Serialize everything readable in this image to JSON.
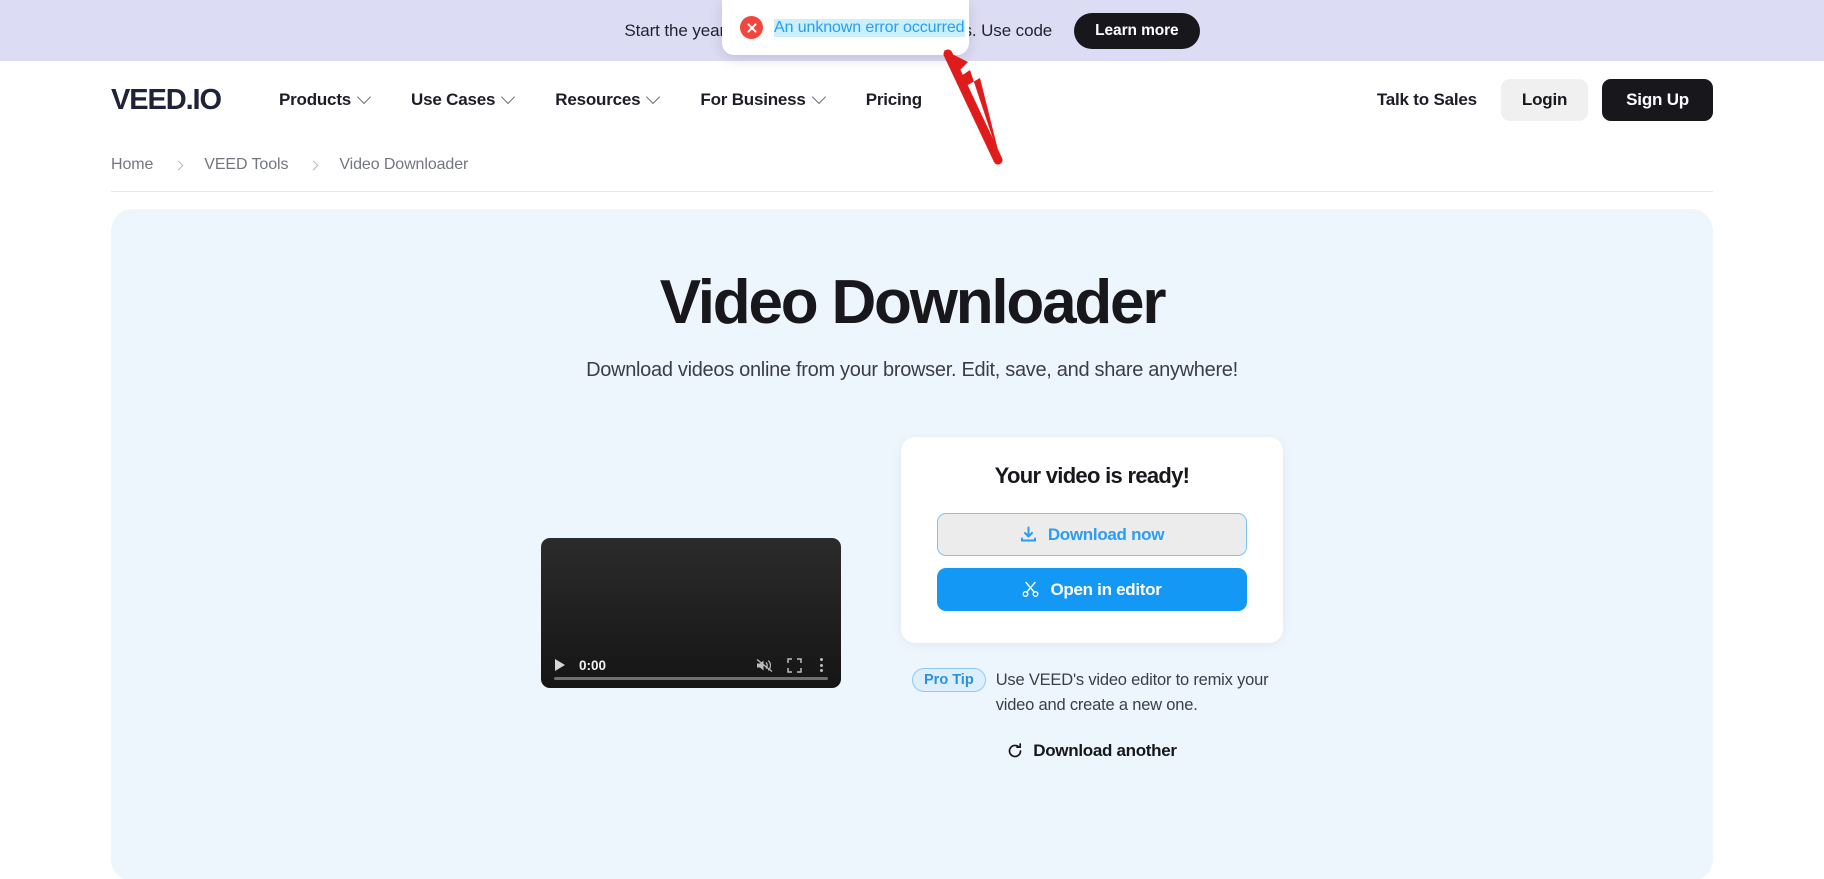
{
  "banner": {
    "text": "Start the year strong with 25% off annual plans. Use code",
    "cta_label": "Learn more"
  },
  "toast": {
    "message": "An unknown error occurred",
    "icon": "error-circle-x-icon",
    "accent_color": "#2a9df4",
    "icon_color": "#f2453d"
  },
  "header": {
    "logo": "VEED.IO",
    "nav": [
      {
        "label": "Products",
        "has_chevron": true
      },
      {
        "label": "Use Cases",
        "has_chevron": true
      },
      {
        "label": "Resources",
        "has_chevron": true
      },
      {
        "label": "For Business",
        "has_chevron": true
      },
      {
        "label": "Pricing",
        "has_chevron": false
      }
    ],
    "talk_to_sales": "Talk to Sales",
    "login": "Login",
    "signup": "Sign Up"
  },
  "breadcrumb": {
    "items": [
      "Home",
      "VEED Tools",
      "Video Downloader"
    ]
  },
  "hero": {
    "title": "Video Downloader",
    "subtitle": "Download videos online from your browser. Edit, save, and share anywhere!"
  },
  "player": {
    "current_time": "0:00",
    "play_icon": "play-icon",
    "mute_icon": "muted-volume-icon",
    "fullscreen_icon": "fullscreen-icon",
    "menu_icon": "kebab-menu-icon"
  },
  "card": {
    "title": "Your video is ready!",
    "download_label": "Download now",
    "download_icon": "download-icon",
    "editor_label": "Open in editor",
    "editor_icon": "scissors-icon",
    "accent_blue": "#1398f5"
  },
  "pro_tip": {
    "badge": "Pro Tip",
    "text": "Use VEED's video editor to remix your video and create a new one."
  },
  "download_another": {
    "label": "Download another",
    "icon": "refresh-icon"
  }
}
